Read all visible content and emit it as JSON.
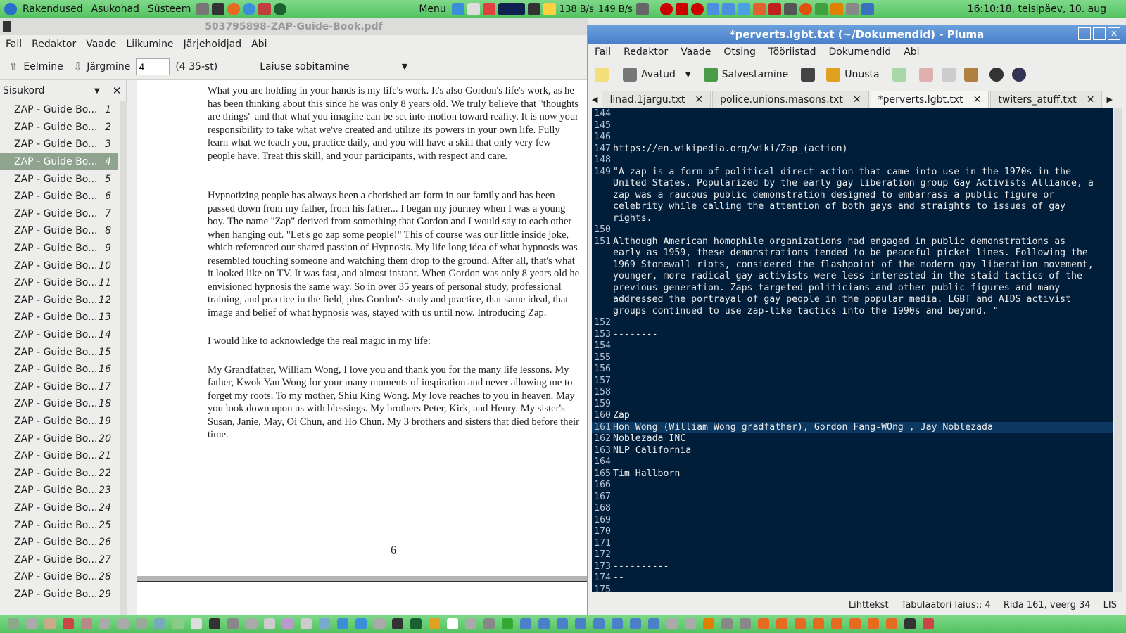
{
  "top_panel": {
    "menus": [
      "Rakendused",
      "Asukohad",
      "Süsteem"
    ],
    "menu_button": "Menu",
    "net_down": "138 B/s",
    "net_up": "149 B/s",
    "clock": "16:10:18, teisipäev, 10. aug"
  },
  "evince": {
    "title": "503795898-ZAP-Guide-Book.pdf",
    "menu": [
      "Fail",
      "Redaktor",
      "Vaade",
      "Liikumine",
      "Järjehoidjad",
      "Abi"
    ],
    "prev_label": "Eelmine",
    "next_label": "Järgmine",
    "page_input": "4",
    "page_count": "(4 35-st)",
    "zoom": "Laiuse sobitamine",
    "sidebar_title": "Sisukord",
    "thumb_label": "ZAP - Guide Bo...",
    "thumb_numbers": [
      "1",
      "2",
      "3",
      "4",
      "5",
      "6",
      "7",
      "8",
      "9",
      "10",
      "11",
      "12",
      "13",
      "14",
      "15",
      "16",
      "17",
      "18",
      "19",
      "20",
      "21",
      "22",
      "23",
      "24",
      "25",
      "26",
      "27",
      "28",
      "29"
    ],
    "selected_page": "4",
    "page_paragraphs": [
      "What you are holding in your hands is my life's work.  It's also Gordon's life's work, as he has been thinking about this since he was only 8 years old.  We truly believe that \"thoughts are things\" and that what you imagine can be set into motion toward reality.  It is now your responsibility to take what we've created and utilize its powers in your own life.  Fully learn what we teach you, practice daily, and you will have a skill that only very few people have.  Treat this skill, and your participants, with respect and care.",
      "Hypnotizing people has always been a cherished art form in our family and has been passed down from my father, from his father...  I began my journey when I was a young boy.  The name \"Zap\" derived from something that Gordon and I would say to each other when hanging out.  \"Let's go zap some people!\"  This of course was our little inside joke, which referenced our shared passion of Hypnosis.  My life long idea of what hypnosis was resembled touching someone and watching them drop to the ground.  After all, that's what it looked like on TV.  It was fast, and almost instant.  When Gordon was only 8 years old he envisioned hypnosis the same way.  So in over 35 years of personal study, professional training, and practice in the field, plus Gordon's study and practice, that same ideal, that image and belief of what hypnosis was, stayed with us until now.  Introducing Zap.",
      "I would like to acknowledge the real magic in my life:",
      "My Grandfather, William Wong, I love you and thank you for the many life lessons. My father, Kwok Yan Wong for your many moments of inspiration and never allowing me to forget my roots. To my mother, Shiu King Wong. My love reaches to you in heaven. May you look down upon us with blessings. My brothers Peter, Kirk, and Henry. My sister's Susan, Janie, May, Oi Chun, and Ho Chun.  My 3 brothers and sisters that died before their time."
    ],
    "page_number": "6"
  },
  "pluma": {
    "title": "*perverts.lgbt.txt (~/Dokumendid) - Pluma",
    "menu": [
      "Fail",
      "Redaktor",
      "Vaade",
      "Otsing",
      "Tööriistad",
      "Dokumendid",
      "Abi"
    ],
    "open_label": "Avatud",
    "save_label": "Salvestamine",
    "undo_label": "Unusta",
    "tabs": [
      "linad.1jargu.txt",
      "police.unions.masons.txt",
      "*perverts.lgbt.txt",
      "twiters_atuff.txt"
    ],
    "active_tab": "*perverts.lgbt.txt",
    "lines": [
      {
        "no": "144",
        "text": ""
      },
      {
        "no": "145",
        "text": ""
      },
      {
        "no": "146",
        "text": ""
      },
      {
        "no": "147",
        "text": "https://en.wikipedia.org/wiki/Zap_(action)"
      },
      {
        "no": "148",
        "text": ""
      },
      {
        "no": "149",
        "text": "\"A zap is a form of political direct action that came into use in the 1970s in the"
      },
      {
        "no": "",
        "text": "United States. Popularized by the early gay liberation group Gay Activists Alliance, a"
      },
      {
        "no": "",
        "text": "zap was a raucous public demonstration designed to embarrass a public figure or"
      },
      {
        "no": "",
        "text": "celebrity while calling the attention of both gays and straights to issues of gay"
      },
      {
        "no": "",
        "text": "rights."
      },
      {
        "no": "150",
        "text": ""
      },
      {
        "no": "151",
        "text": "Although American homophile organizations had engaged in public demonstrations as"
      },
      {
        "no": "",
        "text": "early as 1959, these demonstrations tended to be peaceful picket lines. Following the"
      },
      {
        "no": "",
        "text": "1969 Stonewall riots, considered the flashpoint of the modern gay liberation movement,"
      },
      {
        "no": "",
        "text": "younger, more radical gay activists were less interested in the staid tactics of the"
      },
      {
        "no": "",
        "text": "previous generation. Zaps targeted politicians and other public figures and many"
      },
      {
        "no": "",
        "text": "addressed the portrayal of gay people in the popular media. LGBT and AIDS activist"
      },
      {
        "no": "",
        "text": "groups continued to use zap-like tactics into the 1990s and beyond. \""
      },
      {
        "no": "152",
        "text": ""
      },
      {
        "no": "153",
        "text": "--------"
      },
      {
        "no": "154",
        "text": ""
      },
      {
        "no": "155",
        "text": ""
      },
      {
        "no": "156",
        "text": ""
      },
      {
        "no": "157",
        "text": ""
      },
      {
        "no": "158",
        "text": ""
      },
      {
        "no": "159",
        "text": ""
      },
      {
        "no": "160",
        "text": "Zap"
      },
      {
        "no": "161",
        "text": "Hon Wong (William Wong gradfather), Gordon Fang-WOng , Jay Noblezada"
      },
      {
        "no": "162",
        "text": "Noblezada INC"
      },
      {
        "no": "163",
        "text": "NLP California"
      },
      {
        "no": "164",
        "text": ""
      },
      {
        "no": "165",
        "text": "Tim Hallborn"
      },
      {
        "no": "166",
        "text": ""
      },
      {
        "no": "167",
        "text": ""
      },
      {
        "no": "168",
        "text": ""
      },
      {
        "no": "169",
        "text": ""
      },
      {
        "no": "170",
        "text": ""
      },
      {
        "no": "171",
        "text": ""
      },
      {
        "no": "172",
        "text": ""
      },
      {
        "no": "173",
        "text": "----------"
      },
      {
        "no": "174",
        "text": "--"
      },
      {
        "no": "175",
        "text": ""
      }
    ],
    "current_line": "161",
    "status_lang": "Lihttekst",
    "status_tab": "Tabulaatori laius:: 4",
    "status_pos": "Rida 161, veerg 34",
    "status_mode": "LIS"
  }
}
